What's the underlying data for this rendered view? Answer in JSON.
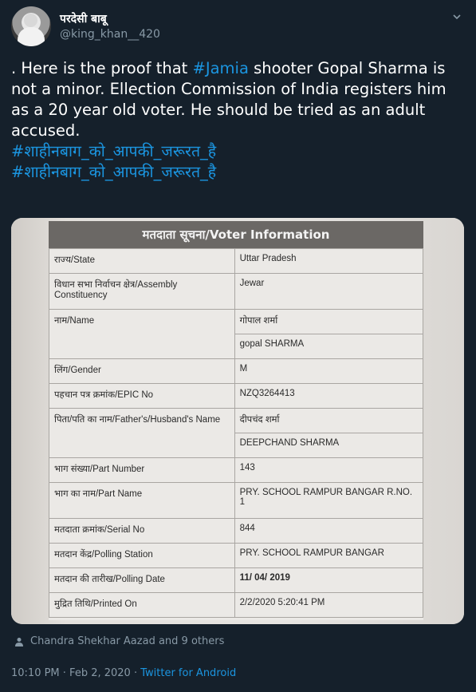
{
  "user": {
    "display_name": "परदेसी बाबू",
    "handle": "@king_khan__420"
  },
  "tweet": {
    "line1_pre": ". Here is the proof that ",
    "line1_tag": "#Jamia",
    "line1_post": " shooter Gopal Sharma is",
    "line2": "not a minor. Ellection Commission of India registers him",
    "line3": "as a 20 year old voter. He should be tried as an adult",
    "line4": "accused.",
    "hashtag1": "#शाहीनबाग_को_आपकी_जरूरत_है",
    "hashtag2": "#शाहीनबाग_को_आपकी_जरूरत_है"
  },
  "card": {
    "title": "मतदाता सूचना/Voter Information",
    "rows": [
      {
        "k": "राज्य/State",
        "v": "Uttar Pradesh"
      },
      {
        "k": "विधान सभा निर्वाचन क्षेत्र/Assembly Constituency",
        "v": "Jewar"
      },
      {
        "k": "नाम/Name",
        "v": "गोपाल शर्मा",
        "v2": "gopal SHARMA"
      },
      {
        "k": "लिंग/Gender",
        "v": "M"
      },
      {
        "k": "पहचान पत्र क्रमांक/EPIC No",
        "v": "NZQ3264413"
      },
      {
        "k": "पिता/पति का नाम/Father's/Husband's Name",
        "v": "दीपचंद शर्मा",
        "v2": "DEEPCHAND SHARMA"
      },
      {
        "k": "भाग संख्या/Part Number",
        "v": "143"
      },
      {
        "k": "भाग का नाम/Part Name",
        "v": "PRY. SCHOOL RAMPUR BANGAR R.NO. 1"
      },
      {
        "k": "मतदाता क्रमांक/Serial No",
        "v": "844"
      },
      {
        "k": "मतदान केंद्र/Polling Station",
        "v": "PRY. SCHOOL RAMPUR BANGAR"
      },
      {
        "k": "मतदान की तारीख/Polling Date",
        "v": "11/ 04/ 2019"
      },
      {
        "k": "मुद्रित तिथि/Printed On",
        "v": "2/2/2020 5:20:41 PM"
      }
    ]
  },
  "likes_text": "Chandra Shekhar Aazad and 9 others",
  "meta": {
    "time": "10:10 PM · Feb 2, 2020 · ",
    "source": "Twitter for Android"
  },
  "colors": {
    "background": "#15202b",
    "link": "#1b95e0",
    "muted": "#8899a6"
  },
  "icons": [
    "avatar",
    "chevron-down-icon",
    "person-icon"
  ]
}
